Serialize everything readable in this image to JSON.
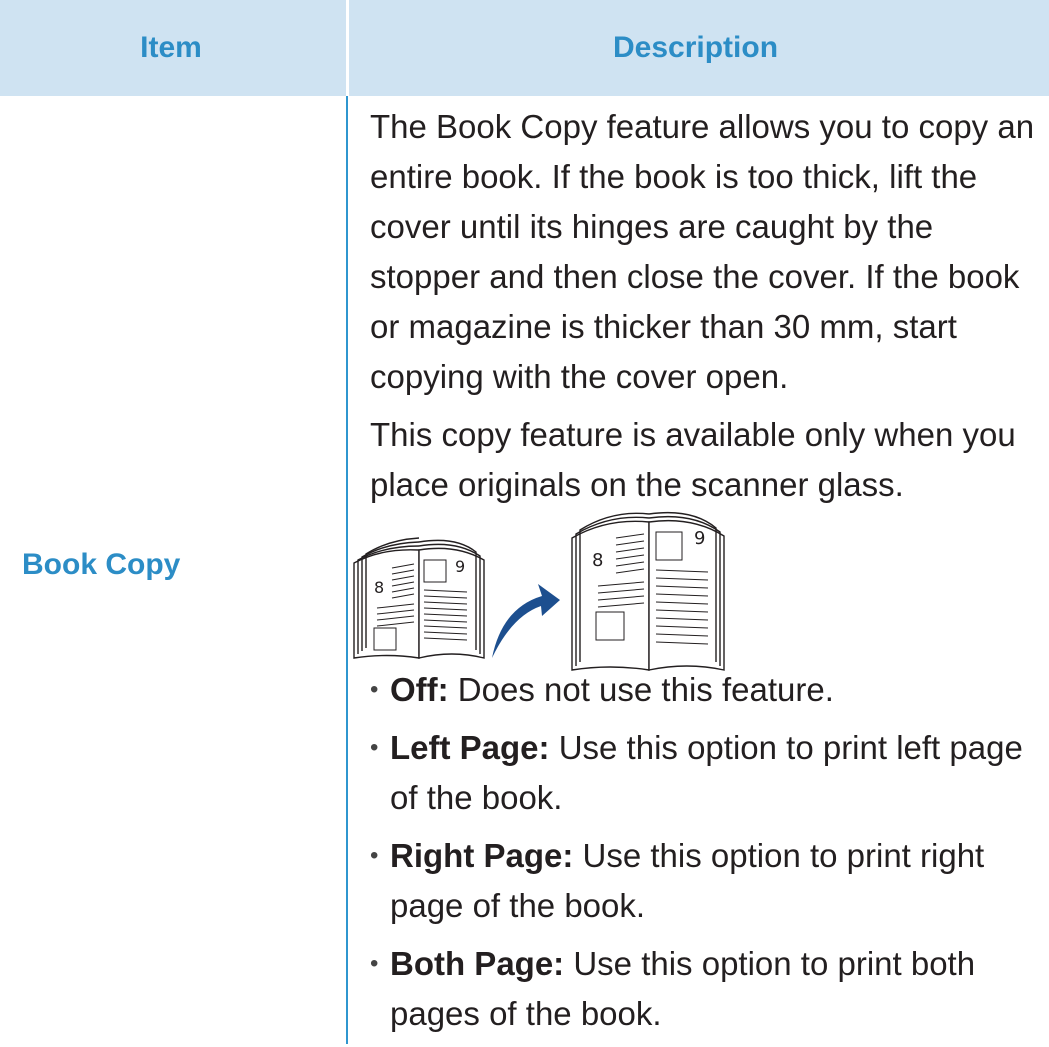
{
  "table": {
    "headers": {
      "item": "Item",
      "description": "Description"
    },
    "row": {
      "item": "Book Copy",
      "paragraphs": [
        "The Book Copy feature allows you to copy an entire book. If the book is too thick, lift the cover until its hinges are caught by the stopper and then close the cover. If the book or magazine is thicker than 30 mm, start copying with the cover open.",
        "This copy feature is available only when you place originals on the scanner glass."
      ],
      "bullets": [
        {
          "label": "Off:",
          "text": " Does not use this feature."
        },
        {
          "label": "Left Page:",
          "text": " Use this option to print left page of the book."
        },
        {
          "label": "Right Page:",
          "text": " Use this option to print right page of the book."
        },
        {
          "label": "Both Page:",
          "text": " Use this option to print both pages of the book."
        }
      ]
    }
  },
  "illustration": {
    "left_book_pages": [
      "8",
      "9"
    ],
    "right_book_pages": [
      "8",
      "9"
    ],
    "arrow": "curved-arrow-icon"
  },
  "colors": {
    "header_bg": "#cfe3f2",
    "accent": "#2c8dc6",
    "divider": "#2f96cf",
    "body_text": "#231f20",
    "arrow": "#1d4f8f"
  }
}
